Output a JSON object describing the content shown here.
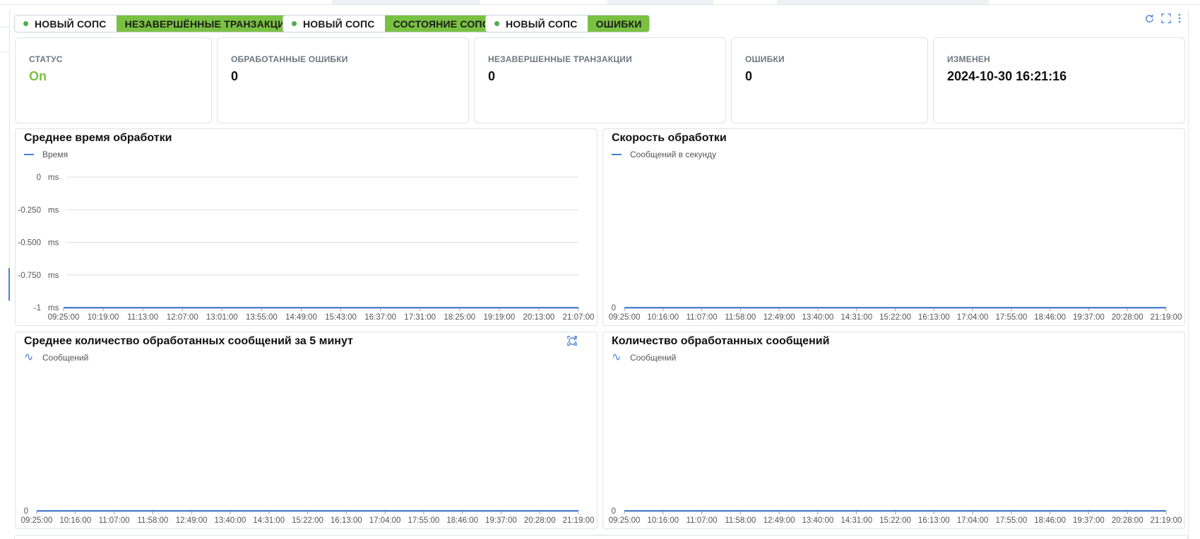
{
  "tabs": [
    {
      "name": "НОВЫЙ СОПС",
      "view": "НЕЗАВЕРШЁННЫЕ ТРАНЗАКЦИИ"
    },
    {
      "name": "НОВЫЙ СОПС",
      "view": "СОСТОЯНИЕ СОПС"
    },
    {
      "name": "НОВЫЙ СОПС",
      "view": "ОШИБКИ"
    }
  ],
  "toolbar": {
    "icons": [
      "refresh-icon",
      "fullscreen-icon",
      "more-vertical-icon"
    ]
  },
  "cards": [
    {
      "label": "СТАТУС",
      "value": "On"
    },
    {
      "label": "ОБРАБОТАННЫЕ ОШИБКИ",
      "value": "0"
    },
    {
      "label": "НЕЗАВЕРШЕННЫЕ ТРАНЗАКЦИИ",
      "value": "0"
    },
    {
      "label": "ОШИБКИ",
      "value": "0"
    },
    {
      "label": "ИЗМЕНЕН",
      "value": "2024-10-30 16:21:16"
    }
  ],
  "colors": {
    "accent": "#79c142",
    "line": "#4a7fd6",
    "status_on": "#79c142",
    "icon": "#5b8fd9"
  },
  "chart_data": [
    {
      "type": "line",
      "title": "Среднее время обработки",
      "series": [
        {
          "name": "Время",
          "values": [
            -1,
            -1,
            -1,
            -1,
            -1,
            -1,
            -1,
            -1,
            -1,
            -1,
            -1,
            -1,
            -1,
            -1
          ]
        }
      ],
      "y_ticks": [
        {
          "value": 0,
          "label": "0"
        },
        {
          "value": -0.25,
          "label": "-0.250"
        },
        {
          "value": -0.5,
          "label": "-0.500"
        },
        {
          "value": -0.75,
          "label": "-0.750"
        },
        {
          "value": -1,
          "label": "-1"
        }
      ],
      "y_unit": "ms",
      "ylim": [
        -1,
        0
      ],
      "grid": true,
      "x": [
        "09:25:00",
        "10:19:00",
        "11:13:00",
        "12:07:00",
        "13:01:00",
        "13:55:00",
        "14:49:00",
        "15:43:00",
        "16:37:00",
        "17:31:00",
        "18:25:00",
        "19:19:00",
        "20:13:00",
        "21:07:00"
      ]
    },
    {
      "type": "line",
      "title": "Скорость обработки",
      "series": [
        {
          "name": "Сообщений в секунду",
          "values": [
            0,
            0,
            0,
            0,
            0,
            0,
            0,
            0,
            0,
            0,
            0,
            0,
            0,
            0,
            0
          ]
        }
      ],
      "y_ticks": [
        {
          "value": 0,
          "label": "0"
        }
      ],
      "y_unit": "",
      "grid": false,
      "x": [
        "09:25:00",
        "10:16:00",
        "11:07:00",
        "11:58:00",
        "12:49:00",
        "13:40:00",
        "14:31:00",
        "15:22:00",
        "16:13:00",
        "17:04:00",
        "17:55:00",
        "18:46:00",
        "19:37:00",
        "20:28:00",
        "21:19:00"
      ]
    },
    {
      "type": "line",
      "title": "Среднее количество обработанных сообщений за 5 минут",
      "series": [
        {
          "name": "Сообщений",
          "values": [
            0,
            0,
            0,
            0,
            0,
            0,
            0,
            0,
            0,
            0,
            0,
            0,
            0,
            0,
            0
          ]
        }
      ],
      "y_ticks": [
        {
          "value": 0,
          "label": "0"
        }
      ],
      "y_unit": "",
      "grid": false,
      "x": [
        "09:25:00",
        "10:16:00",
        "11:07:00",
        "11:58:00",
        "12:49:00",
        "13:40:00",
        "14:31:00",
        "15:22:00",
        "16:13:00",
        "17:04:00",
        "17:55:00",
        "18:46:00",
        "19:37:00",
        "20:28:00",
        "21:19:00"
      ]
    },
    {
      "type": "line",
      "title": "Количество обработанных сообщений",
      "series": [
        {
          "name": "Сообщений",
          "values": [
            0,
            0,
            0,
            0,
            0,
            0,
            0,
            0,
            0,
            0,
            0,
            0,
            0,
            0,
            0
          ]
        }
      ],
      "y_ticks": [
        {
          "value": 0,
          "label": "0"
        }
      ],
      "y_unit": "",
      "grid": false,
      "x": [
        "09:25:00",
        "10:16:00",
        "11:07:00",
        "11:58:00",
        "12:49:00",
        "13:40:00",
        "14:31:00",
        "15:22:00",
        "16:13:00",
        "17:04:00",
        "17:55:00",
        "18:46:00",
        "19:37:00",
        "20:28:00",
        "21:19:00"
      ]
    }
  ]
}
